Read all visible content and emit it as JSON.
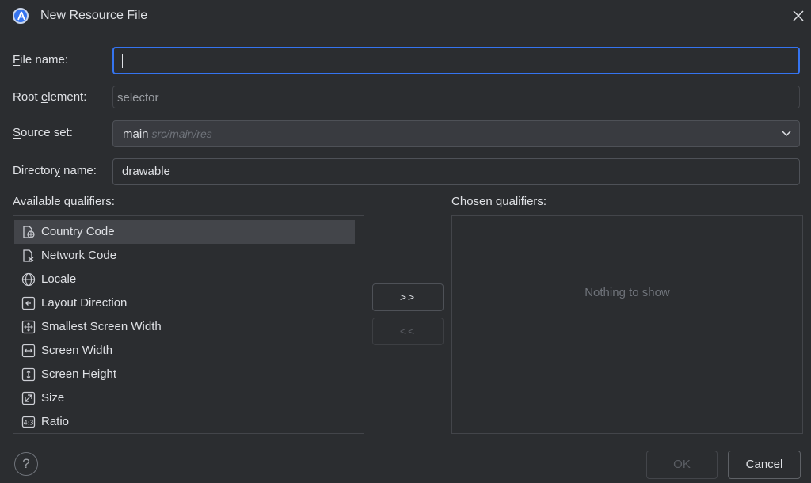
{
  "window": {
    "title": "New Resource File"
  },
  "form": {
    "file_name": {
      "label_prefix": "F",
      "label_rest": "ile name:",
      "value": ""
    },
    "root_element": {
      "label_prefix": "Root ",
      "label_ul": "e",
      "label_rest": "lement:",
      "value": "selector"
    },
    "source_set": {
      "label_ul": "S",
      "label_rest": "ource set:",
      "value": "main",
      "path": "src/main/res"
    },
    "directory_name": {
      "label_prefix": "Director",
      "label_ul": "y",
      "label_rest": " name:",
      "value": "drawable"
    }
  },
  "available": {
    "label_prefix": "A",
    "label_ul": "v",
    "label_rest": "ailable qualifiers:",
    "items": [
      {
        "label": "Country Code",
        "icon": "country-code-icon"
      },
      {
        "label": "Network Code",
        "icon": "network-code-icon"
      },
      {
        "label": "Locale",
        "icon": "globe-icon"
      },
      {
        "label": "Layout Direction",
        "icon": "layout-direction-icon"
      },
      {
        "label": "Smallest Screen Width",
        "icon": "smallest-width-icon"
      },
      {
        "label": "Screen Width",
        "icon": "screen-width-icon"
      },
      {
        "label": "Screen Height",
        "icon": "screen-height-icon"
      },
      {
        "label": "Size",
        "icon": "size-icon"
      },
      {
        "label": "Ratio",
        "icon": "ratio-icon"
      }
    ]
  },
  "buttons": {
    "add": ">>",
    "remove": "<<",
    "ok": "OK",
    "cancel": "Cancel",
    "help": "?"
  },
  "chosen": {
    "label_prefix": "C",
    "label_ul": "h",
    "label_rest": "osen qualifiers:",
    "empty_text": "Nothing to show"
  },
  "colors": {
    "background": "#2b2d30",
    "accent": "#3574f0",
    "text": "#dfe1e5",
    "muted": "#6f737a"
  }
}
